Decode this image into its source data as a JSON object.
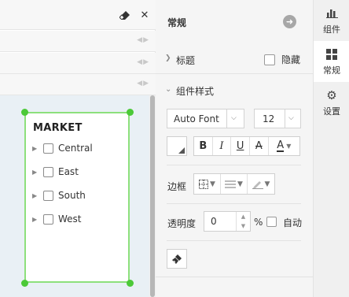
{
  "left": {
    "widget": {
      "title": "MARKET",
      "items": [
        "Central",
        "East",
        "South",
        "West"
      ]
    }
  },
  "panel": {
    "title": "常规",
    "sections": {
      "title_label": "标题",
      "hide_label": "隐藏",
      "component_style_label": "组件样式"
    },
    "font": {
      "family": "Auto Font",
      "size": "12"
    },
    "format_buttons": [
      "B",
      "I",
      "U",
      "A"
    ],
    "font_color_label": "A",
    "border_label": "边框",
    "opacity": {
      "label": "透明度",
      "value": "0",
      "unit": "%",
      "auto_label": "自动"
    }
  },
  "tabs": [
    {
      "label": "组件",
      "icon": "bar-chart-icon"
    },
    {
      "label": "常规",
      "icon": "grid-icon"
    },
    {
      "label": "设置",
      "icon": "gear-icon"
    }
  ],
  "colors": {
    "selection": "#8de07c",
    "handle": "#4cc938",
    "canvas": "#e9f0f5"
  }
}
